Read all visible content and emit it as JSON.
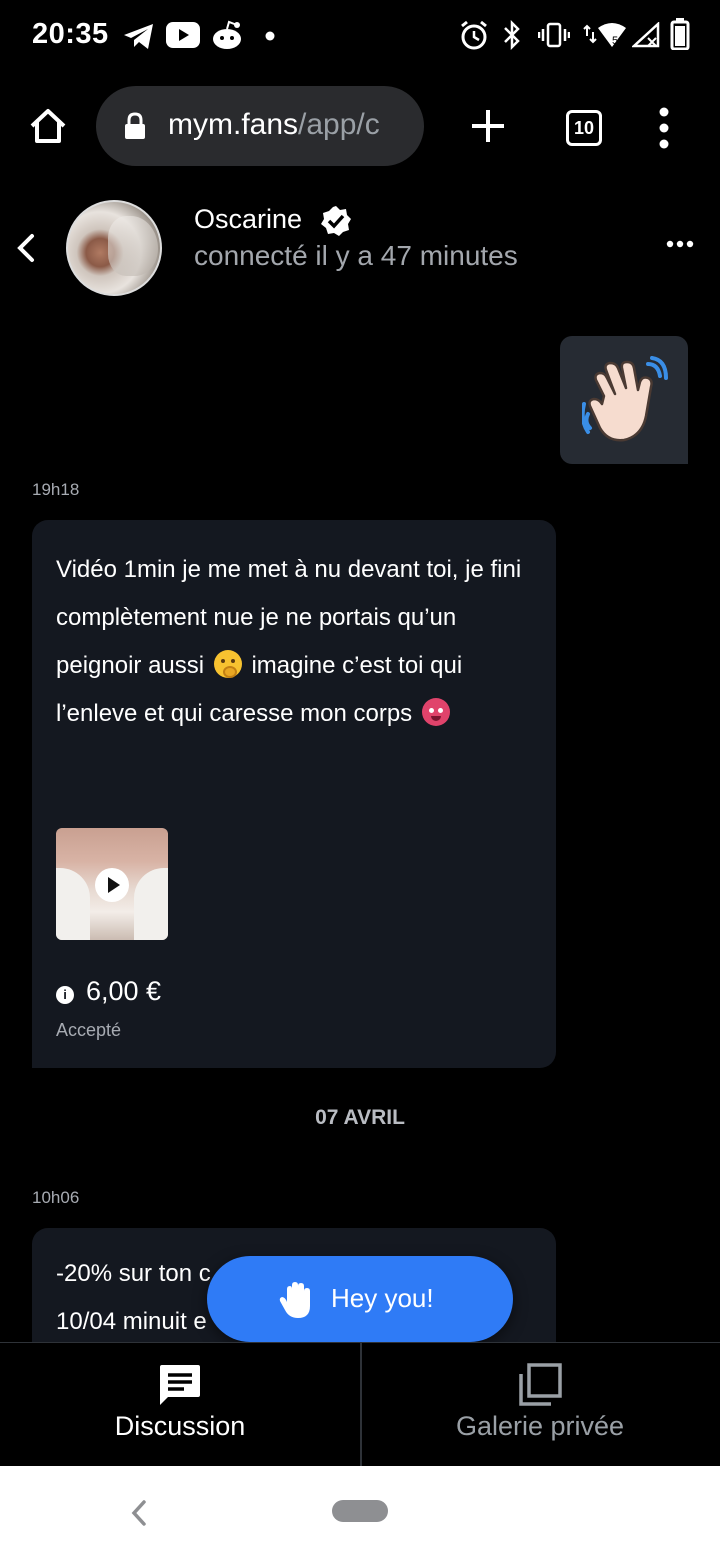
{
  "status_bar": {
    "time": "20:35",
    "left_icons": [
      "telegram-icon",
      "youtube-icon",
      "reddit-icon",
      "notification-dot-icon"
    ],
    "right_icons": [
      "alarm-icon",
      "bluetooth-icon",
      "vibrate-icon",
      "wifi-icon",
      "signal-icon",
      "battery-icon"
    ]
  },
  "browser": {
    "url_host": "mym.fans",
    "url_path": "/app/c",
    "tab_count": "10"
  },
  "header": {
    "name": "Oscarine",
    "status": "connecté il y a 47 minutes"
  },
  "messages": {
    "sent_emoji": "waving-hand-emoji",
    "time_1": "19h18",
    "card_1": {
      "line_a": "Vidéo 1min je me met à nu devant toi, je fini complètement nue je ne portais qu’un peignoir aussi",
      "line_b": "imagine c’est toi qui l’enleve et qui caresse mon corps",
      "price": "6,00 €",
      "status": "Accepté"
    },
    "date_separator": "07 AVRIL",
    "time_2": "10h06",
    "card_2": {
      "line_1": "-20% sur ton c",
      "line_2": "10/04 minuit e"
    }
  },
  "floating_button": {
    "label": "Hey you!"
  },
  "tabs": [
    {
      "label": "Discussion",
      "active": true
    },
    {
      "label": "Galerie privée",
      "active": false
    }
  ],
  "colors": {
    "accent": "#2f7bf6",
    "card_bg": "#141820",
    "muted_text": "#a7abb2",
    "inactive_tab": "#9aa0a6"
  }
}
